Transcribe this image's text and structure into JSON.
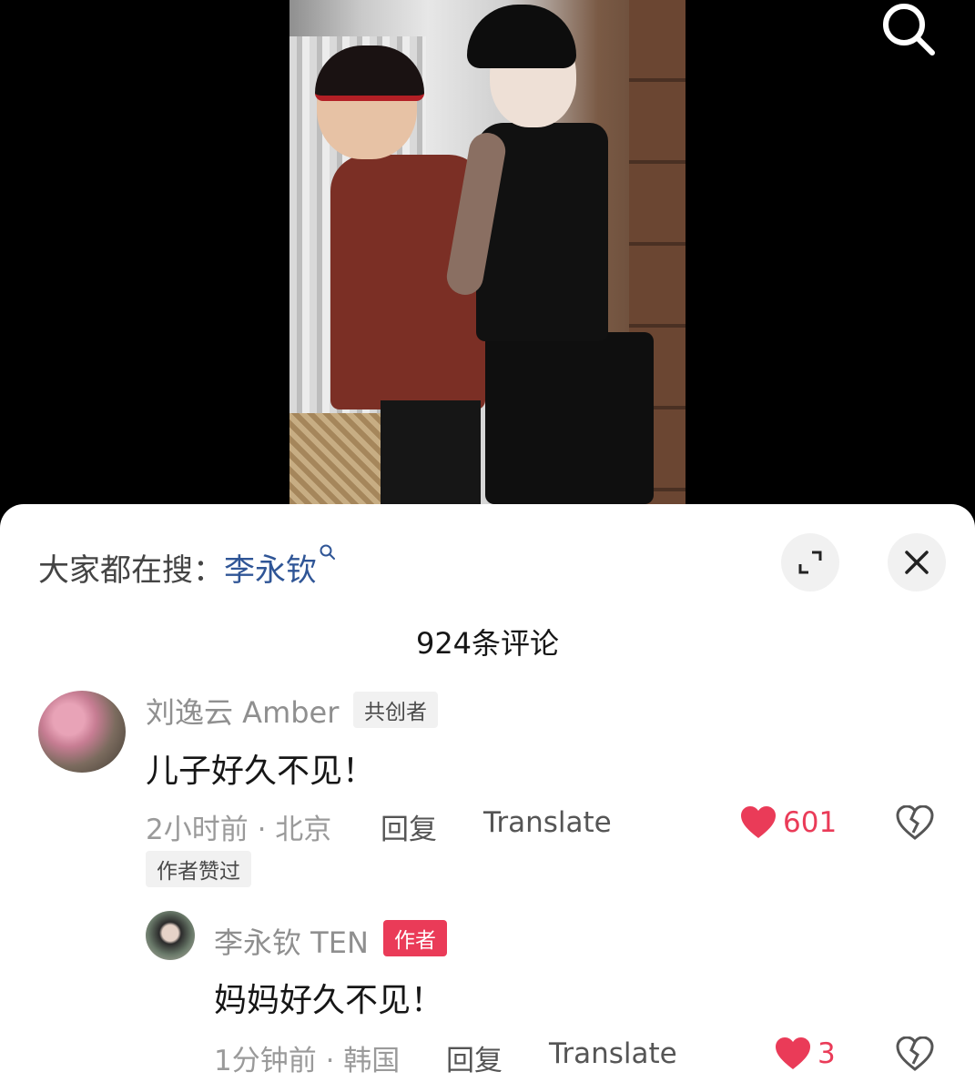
{
  "search_bar": {
    "prefix": "大家都在搜：",
    "keyword": "李永钦"
  },
  "comments_header": {
    "count_label": "924条评论"
  },
  "comments": [
    {
      "author": "刘逸云 Amber",
      "badge": "共创者",
      "text": "儿子好久不见！",
      "meta": "2小时前 · 北京",
      "reply_label": "回复",
      "translate_label": "Translate",
      "likes": "601",
      "liked": true,
      "author_liked_tag": "作者赞过",
      "replies": [
        {
          "author": "李永钦 TEN",
          "badge": "作者",
          "text": "妈妈好久不见！",
          "meta": "1分钟前 · 韩国",
          "reply_label": "回复",
          "translate_label": "Translate",
          "likes": "3",
          "liked": true
        }
      ]
    }
  ],
  "colors": {
    "accent_red": "#ea3b58",
    "keyword_blue": "#2f5596"
  }
}
